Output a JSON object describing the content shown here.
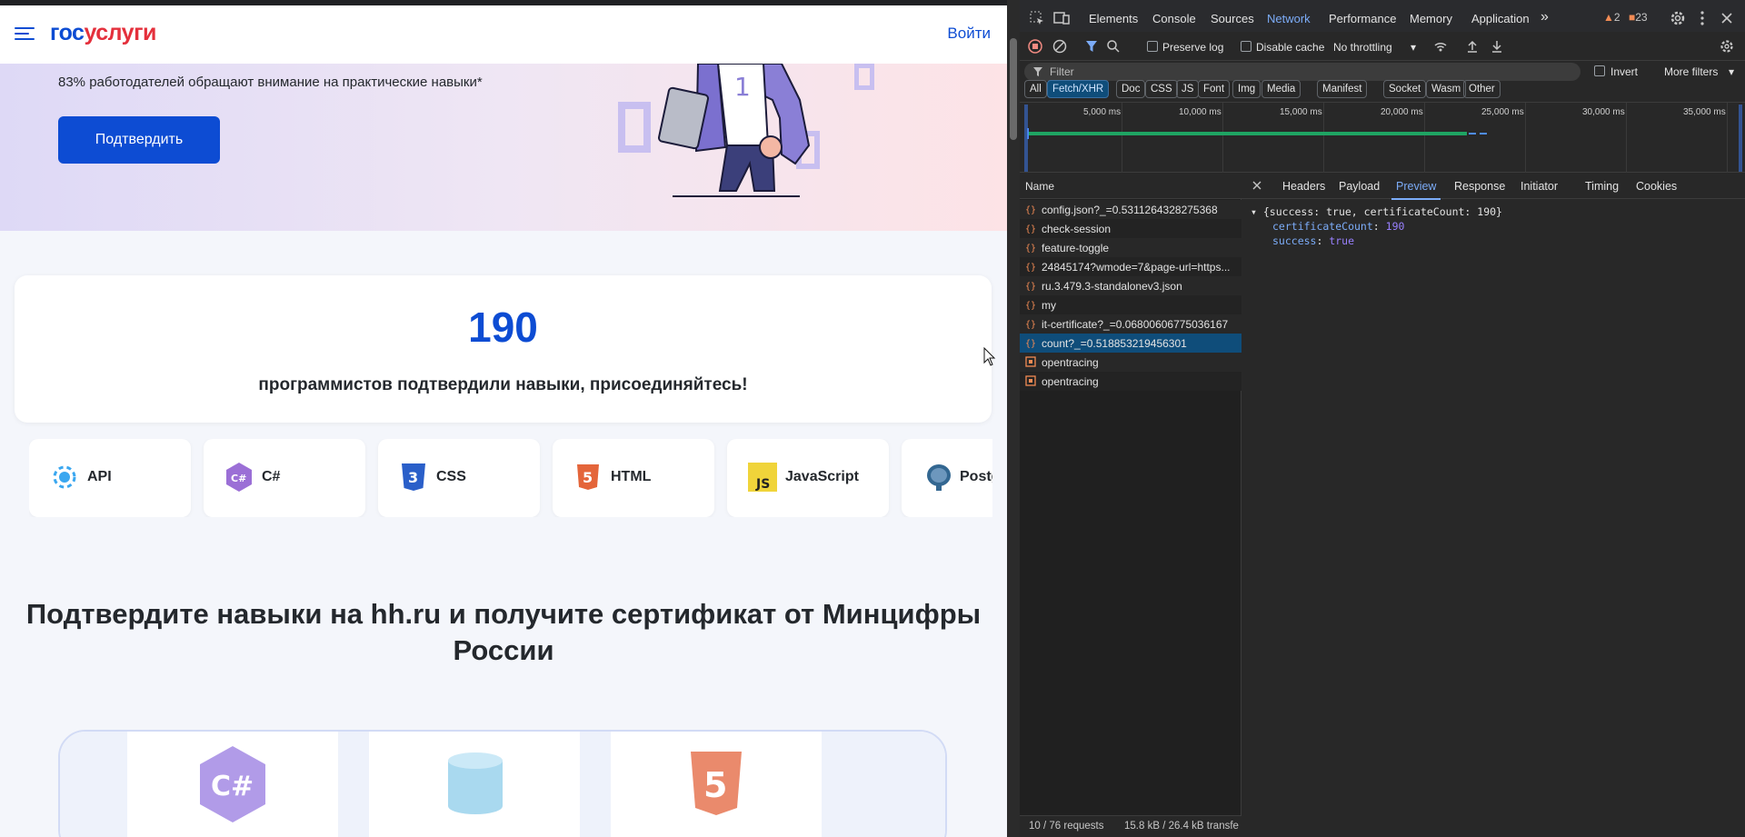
{
  "site": {
    "logo_part1": "гос",
    "logo_part2": "услуги",
    "login_label": "Войти",
    "hero_text": "83% работодателей обращают внимание на практические навыки*",
    "confirm_button": "Подтвердить",
    "counter_value": "190",
    "counter_label": "программистов подтвердили навыки, присоединяйтесь!",
    "skills": [
      {
        "name": "API",
        "icon": "api-icon"
      },
      {
        "name": "C#",
        "icon": "csharp-icon"
      },
      {
        "name": "CSS",
        "icon": "css3-icon"
      },
      {
        "name": "HTML",
        "icon": "html5-icon"
      },
      {
        "name": "JavaScript",
        "icon": "javascript-icon"
      },
      {
        "name": "Postg",
        "icon": "postgresql-icon"
      }
    ],
    "section_title_line1": "Подтвердите навыки на hh.ru и получите сертификат от Минцифры",
    "section_title_line2": "России",
    "colors": {
      "brand_blue": "#0d4cd3",
      "brand_red": "#e4303c"
    }
  },
  "devtools": {
    "tabs": [
      "Elements",
      "Console",
      "Sources",
      "Network",
      "Performance",
      "Memory",
      "Application"
    ],
    "active_tab": "Network",
    "more_tabs": "»",
    "warnings_count": "2",
    "issues_count": "23",
    "toolbar": {
      "preserve_log": "Preserve log",
      "disable_cache": "Disable cache",
      "throttling": "No throttling"
    },
    "filter_placeholder": "Filter",
    "invert_label": "Invert",
    "more_filters": "More filters",
    "chips": [
      "All",
      "Fetch/XHR",
      "Doc",
      "CSS",
      "JS",
      "Font",
      "Img",
      "Media",
      "Manifest",
      "Socket",
      "Wasm",
      "Other"
    ],
    "active_chip": "Fetch/XHR",
    "timeline_ticks": [
      "5,000 ms",
      "10,000 ms",
      "15,000 ms",
      "20,000 ms",
      "25,000 ms",
      "30,000 ms",
      "35,000 ms"
    ],
    "name_header": "Name",
    "requests": [
      "config.json?_=0.5311264328275368",
      "check-session",
      "feature-toggle",
      "24845174?wmode=7&page-url=https...",
      "ru.3.479.3-standalonev3.json",
      "my",
      "it-certificate?_=0.06800606775036167",
      "count?_=0.518853219456301",
      "opentracing",
      "opentracing"
    ],
    "selected_request": "count?_=0.518853219456301",
    "status_requests": "10 / 76 requests",
    "status_size": "15.8 kB / 26.4 kB transfe",
    "detail_tabs": [
      "Headers",
      "Payload",
      "Preview",
      "Response",
      "Initiator",
      "Timing",
      "Cookies"
    ],
    "active_detail_tab": "Preview",
    "preview": {
      "summary": "{success: true, certificateCount: 190}",
      "key1": "certificateCount",
      "val1": "190",
      "key2": "success",
      "val2": "true"
    }
  }
}
